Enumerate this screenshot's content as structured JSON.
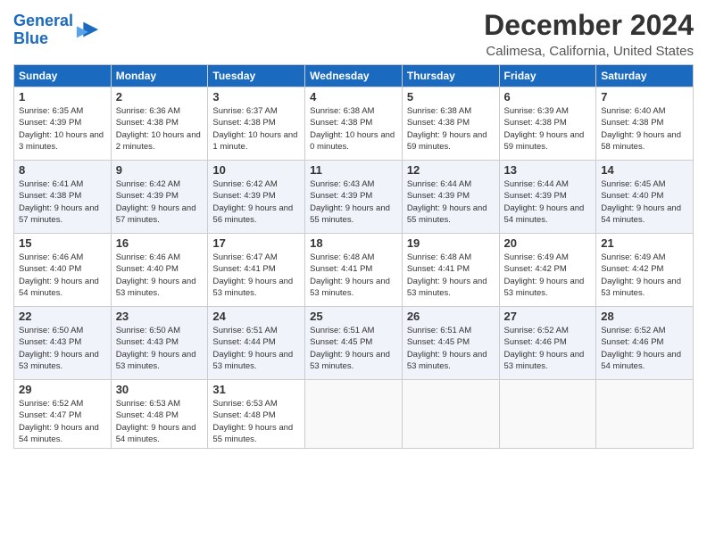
{
  "header": {
    "logo_line1": "General",
    "logo_line2": "Blue",
    "title": "December 2024",
    "subtitle": "Calimesa, California, United States"
  },
  "days_of_week": [
    "Sunday",
    "Monday",
    "Tuesday",
    "Wednesday",
    "Thursday",
    "Friday",
    "Saturday"
  ],
  "weeks": [
    [
      {
        "day": "1",
        "sunrise": "6:35 AM",
        "sunset": "4:39 PM",
        "daylight": "10 hours and 3 minutes."
      },
      {
        "day": "2",
        "sunrise": "6:36 AM",
        "sunset": "4:38 PM",
        "daylight": "10 hours and 2 minutes."
      },
      {
        "day": "3",
        "sunrise": "6:37 AM",
        "sunset": "4:38 PM",
        "daylight": "10 hours and 1 minute."
      },
      {
        "day": "4",
        "sunrise": "6:38 AM",
        "sunset": "4:38 PM",
        "daylight": "10 hours and 0 minutes."
      },
      {
        "day": "5",
        "sunrise": "6:38 AM",
        "sunset": "4:38 PM",
        "daylight": "9 hours and 59 minutes."
      },
      {
        "day": "6",
        "sunrise": "6:39 AM",
        "sunset": "4:38 PM",
        "daylight": "9 hours and 59 minutes."
      },
      {
        "day": "7",
        "sunrise": "6:40 AM",
        "sunset": "4:38 PM",
        "daylight": "9 hours and 58 minutes."
      }
    ],
    [
      {
        "day": "8",
        "sunrise": "6:41 AM",
        "sunset": "4:38 PM",
        "daylight": "9 hours and 57 minutes."
      },
      {
        "day": "9",
        "sunrise": "6:42 AM",
        "sunset": "4:39 PM",
        "daylight": "9 hours and 57 minutes."
      },
      {
        "day": "10",
        "sunrise": "6:42 AM",
        "sunset": "4:39 PM",
        "daylight": "9 hours and 56 minutes."
      },
      {
        "day": "11",
        "sunrise": "6:43 AM",
        "sunset": "4:39 PM",
        "daylight": "9 hours and 55 minutes."
      },
      {
        "day": "12",
        "sunrise": "6:44 AM",
        "sunset": "4:39 PM",
        "daylight": "9 hours and 55 minutes."
      },
      {
        "day": "13",
        "sunrise": "6:44 AM",
        "sunset": "4:39 PM",
        "daylight": "9 hours and 54 minutes."
      },
      {
        "day": "14",
        "sunrise": "6:45 AM",
        "sunset": "4:40 PM",
        "daylight": "9 hours and 54 minutes."
      }
    ],
    [
      {
        "day": "15",
        "sunrise": "6:46 AM",
        "sunset": "4:40 PM",
        "daylight": "9 hours and 54 minutes."
      },
      {
        "day": "16",
        "sunrise": "6:46 AM",
        "sunset": "4:40 PM",
        "daylight": "9 hours and 53 minutes."
      },
      {
        "day": "17",
        "sunrise": "6:47 AM",
        "sunset": "4:41 PM",
        "daylight": "9 hours and 53 minutes."
      },
      {
        "day": "18",
        "sunrise": "6:48 AM",
        "sunset": "4:41 PM",
        "daylight": "9 hours and 53 minutes."
      },
      {
        "day": "19",
        "sunrise": "6:48 AM",
        "sunset": "4:41 PM",
        "daylight": "9 hours and 53 minutes."
      },
      {
        "day": "20",
        "sunrise": "6:49 AM",
        "sunset": "4:42 PM",
        "daylight": "9 hours and 53 minutes."
      },
      {
        "day": "21",
        "sunrise": "6:49 AM",
        "sunset": "4:42 PM",
        "daylight": "9 hours and 53 minutes."
      }
    ],
    [
      {
        "day": "22",
        "sunrise": "6:50 AM",
        "sunset": "4:43 PM",
        "daylight": "9 hours and 53 minutes."
      },
      {
        "day": "23",
        "sunrise": "6:50 AM",
        "sunset": "4:43 PM",
        "daylight": "9 hours and 53 minutes."
      },
      {
        "day": "24",
        "sunrise": "6:51 AM",
        "sunset": "4:44 PM",
        "daylight": "9 hours and 53 minutes."
      },
      {
        "day": "25",
        "sunrise": "6:51 AM",
        "sunset": "4:45 PM",
        "daylight": "9 hours and 53 minutes."
      },
      {
        "day": "26",
        "sunrise": "6:51 AM",
        "sunset": "4:45 PM",
        "daylight": "9 hours and 53 minutes."
      },
      {
        "day": "27",
        "sunrise": "6:52 AM",
        "sunset": "4:46 PM",
        "daylight": "9 hours and 53 minutes."
      },
      {
        "day": "28",
        "sunrise": "6:52 AM",
        "sunset": "4:46 PM",
        "daylight": "9 hours and 54 minutes."
      }
    ],
    [
      {
        "day": "29",
        "sunrise": "6:52 AM",
        "sunset": "4:47 PM",
        "daylight": "9 hours and 54 minutes."
      },
      {
        "day": "30",
        "sunrise": "6:53 AM",
        "sunset": "4:48 PM",
        "daylight": "9 hours and 54 minutes."
      },
      {
        "day": "31",
        "sunrise": "6:53 AM",
        "sunset": "4:48 PM",
        "daylight": "9 hours and 55 minutes."
      },
      null,
      null,
      null,
      null
    ]
  ]
}
